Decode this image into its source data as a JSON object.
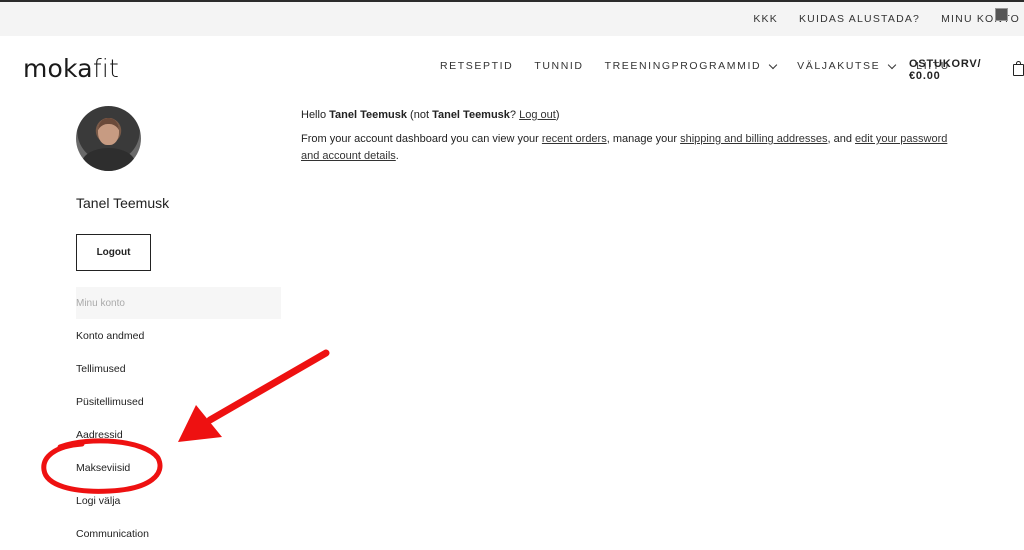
{
  "topbar": {
    "links": [
      "KKK",
      "KUIDAS ALUSTADA?",
      "MINU KONTO"
    ]
  },
  "logo": {
    "part1": "moka",
    "part2": "fit"
  },
  "mainnav": {
    "items": [
      "RETSEPTID",
      "TUNNID",
      "TREENINGPROGRAMMID",
      "VÄLJAKUTSE",
      "LIITU"
    ],
    "cart": "OSTUKORV/€0.00"
  },
  "profile": {
    "name": "Tanel Teemusk",
    "logout_label": "Logout"
  },
  "account_nav": {
    "header": "Minu konto",
    "items": [
      "Konto andmed",
      "Tellimused",
      "Püsitellimused",
      "Aadressid",
      "Makseviisid",
      "Logi välja",
      "Communication"
    ]
  },
  "dashboard": {
    "hello": "Hello",
    "name": "Tanel Teemusk",
    "not_open": "(not",
    "name2": "Tanel Teemusk",
    "question": "?",
    "logout_link": "Log out",
    "close": ")",
    "intro": "From your account dashboard you can view your",
    "recent_orders": "recent orders",
    "manage": ", manage your",
    "addresses": "shipping and billing addresses",
    "and": ", and",
    "edit": "edit your password and account details",
    "dot": "."
  },
  "annotation": {
    "color": "#ee1111"
  }
}
